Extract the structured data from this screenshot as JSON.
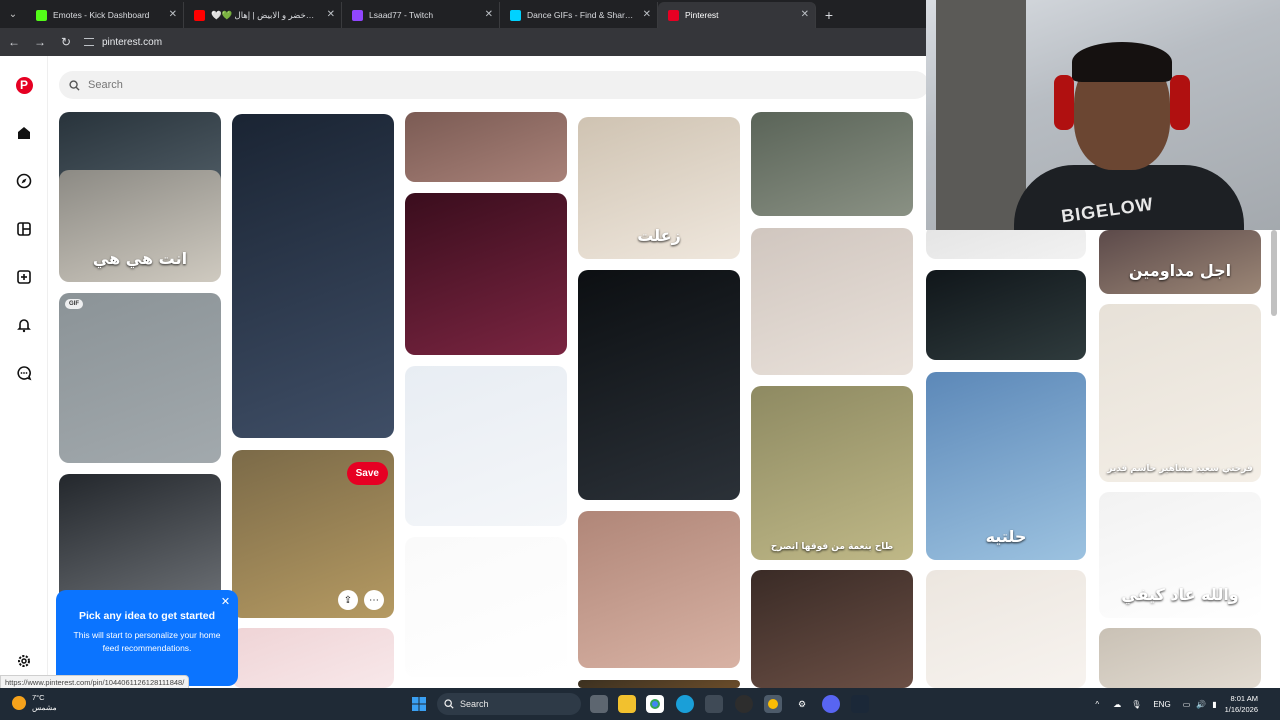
{
  "browser": {
    "tabs": [
      {
        "title": "Emotes - Kick Dashboard",
        "fav_color": "#53fc18",
        "active": false
      },
      {
        "title": "🤍💚 رفرف الاخضر و الابيض | إهال",
        "fav_color": "#ff0000",
        "active": false
      },
      {
        "title": "Lsaad77 - Twitch",
        "fav_color": "#9146ff",
        "active": false
      },
      {
        "title": "Dance GIFs - Find & Share on G",
        "fav_color": "#00d2ff",
        "active": false
      },
      {
        "title": "Pinterest",
        "fav_color": "#e60023",
        "active": true
      }
    ],
    "url": "pinterest.com",
    "status_url": "https://www.pinterest.com/pin/1044061126128111848/"
  },
  "pinterest": {
    "logo": "P",
    "search_placeholder": "Search",
    "rail_icons": [
      "home-icon",
      "explore-icon",
      "boards-icon",
      "create-icon",
      "notifications-icon",
      "messages-icon",
      "settings-icon"
    ],
    "pins": [
      {
        "caption": "",
        "colors": [
          "#28333b",
          "#56636c"
        ]
      },
      {
        "caption": "انت هي هي",
        "colors": [
          "#8c8a84",
          "#cfcac0"
        ]
      },
      {
        "caption": "",
        "badge": "GIF",
        "colors": [
          "#8b9397",
          "#a2a9ad"
        ]
      },
      {
        "caption": "",
        "colors": [
          "#23272c",
          "#6b6f74"
        ]
      },
      {
        "caption": "",
        "colors": [
          "#1a2433",
          "#3f4e66"
        ]
      },
      {
        "caption": "",
        "colors": [
          "#7b6a48",
          "#b59a62"
        ]
      },
      {
        "caption": "",
        "colors": [
          "#efd4d6",
          "#f8e8ea"
        ]
      },
      {
        "caption": "",
        "colors": [
          "#7b5b54",
          "#a88178"
        ]
      },
      {
        "caption": "",
        "colors": [
          "#3a0d1d",
          "#7a2541"
        ]
      },
      {
        "caption": "",
        "colors": [
          "#e8edf3",
          "#f4f6f9"
        ]
      },
      {
        "caption": "",
        "colors": [
          "#fafafa",
          "#ffffff"
        ]
      },
      {
        "caption": "زعلت",
        "colors": [
          "#cfc3b2",
          "#efe7dd"
        ]
      },
      {
        "caption": "",
        "colors": [
          "#0c0f12",
          "#2b3138"
        ]
      },
      {
        "caption": "",
        "colors": [
          "#b08678",
          "#d8b2a4"
        ]
      },
      {
        "caption": "",
        "colors": [
          "#3b3020",
          "#6a4c2a"
        ]
      },
      {
        "caption": "",
        "colors": [
          "#5a6458",
          "#8a9184"
        ]
      },
      {
        "caption": "",
        "colors": [
          "#d0c6bf",
          "#e9e1da"
        ]
      },
      {
        "caption": "طاح بنعمة من فوقها انصرح",
        "colors": [
          "#8e8a62",
          "#bfb887"
        ]
      },
      {
        "caption": "",
        "colors": [
          "#3a2b26",
          "#6b4f45"
        ]
      },
      {
        "caption": "",
        "colors": [
          "#e4e4e4",
          "#f2f2f2"
        ]
      },
      {
        "caption": "اجل مداومين",
        "colors": [
          "#5c4a4a",
          "#9b8676"
        ]
      },
      {
        "caption": "",
        "colors": [
          "#10161a",
          "#2f3b3d"
        ]
      },
      {
        "caption": "حلتيه",
        "colors": [
          "#5c88b8",
          "#9cc2e0"
        ]
      },
      {
        "caption": "",
        "colors": [
          "#ece6df",
          "#f7f3ef"
        ]
      },
      {
        "caption": "فرحتي سعيد مشاهير حاسم قدير",
        "colors": [
          "#e7e1d8",
          "#f4efe7"
        ]
      },
      {
        "caption": "والله عاد كيفي",
        "colors": [
          "#f2f2f2",
          "#ffffff"
        ]
      },
      {
        "caption": "",
        "colors": [
          "#c9c1b5",
          "#e2dbd1"
        ]
      }
    ],
    "save_label": "Save",
    "onboarding": {
      "title": "Pick any idea to get started",
      "body": "This will start to personalize your home feed recommendations."
    }
  },
  "webcam": {
    "shirt_text": "BIGELOW"
  },
  "taskbar": {
    "weather_temp": "7°C",
    "weather_desc": "مشمس",
    "search_label": "Search",
    "lang": "ENG",
    "time": "8:01 AM",
    "date": "1/16/2026"
  }
}
